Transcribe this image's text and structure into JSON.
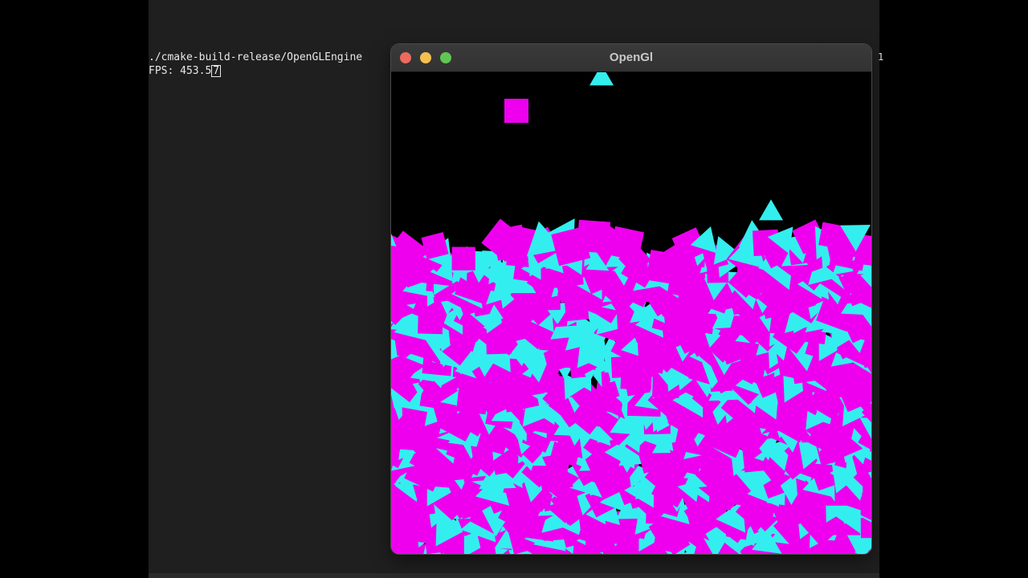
{
  "terminal": {
    "command": "./cmake-build-release/OpenGLEngine",
    "fps_prefix": "FPS: 453.5",
    "fps_cursor_char": "7",
    "edge_glyph": "1"
  },
  "window": {
    "title": "OpenGl"
  },
  "scene": {
    "background": "#000000",
    "square_color": "#ee00ee",
    "triangle_color": "#33eeee",
    "shape_kinds": [
      "square",
      "triangle"
    ]
  },
  "colors": {
    "terminal_bg": "#1f1f1f",
    "desktop_bg": "#000000",
    "titlebar_bg": "#363636",
    "close": "#ed6a5e",
    "minimize": "#f5bf4f",
    "maximize": "#61c554"
  }
}
